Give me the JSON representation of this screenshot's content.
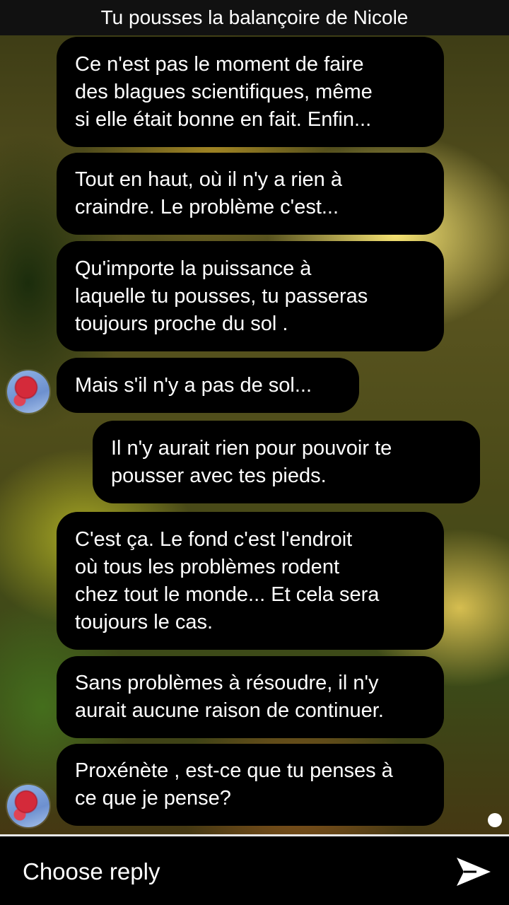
{
  "header": {
    "title": "Tu pousses la balançoire de Nicole"
  },
  "messages": [
    {
      "text": "Ce n'est pas le moment de faire\ndes blagues scientifiques, même\nsi elle était bonne en fait. Enfin...",
      "side": "left"
    },
    {
      "text": "Tout en haut, où il n'y a rien à\ncraindre. Le problème c'est...",
      "side": "left"
    },
    {
      "text": "Qu'importe la puissance à\nlaquelle tu pousses, tu passeras\ntoujours proche du sol .",
      "side": "left"
    },
    {
      "text": "Mais s'il n'y a pas de sol...",
      "side": "left",
      "avatar": "flower-avatar"
    },
    {
      "text": "Il n'y aurait rien pour pouvoir te\npousser avec tes pieds.",
      "side": "right"
    },
    {
      "text": "C'est ça. Le fond c'est l'endroit\noù tous les problèmes rodent\nchez tout le monde... Et cela sera\ntoujours le cas.",
      "side": "left"
    },
    {
      "text": "Sans problèmes à résoudre, il n'y\naurait aucune raison de continuer.",
      "side": "left"
    },
    {
      "text": "Proxénète , est-ce que tu penses à\nce que je pense?",
      "side": "left",
      "avatar": "flower-avatar"
    }
  ],
  "reply": {
    "label": "Choose reply",
    "send_icon": "send-icon"
  }
}
